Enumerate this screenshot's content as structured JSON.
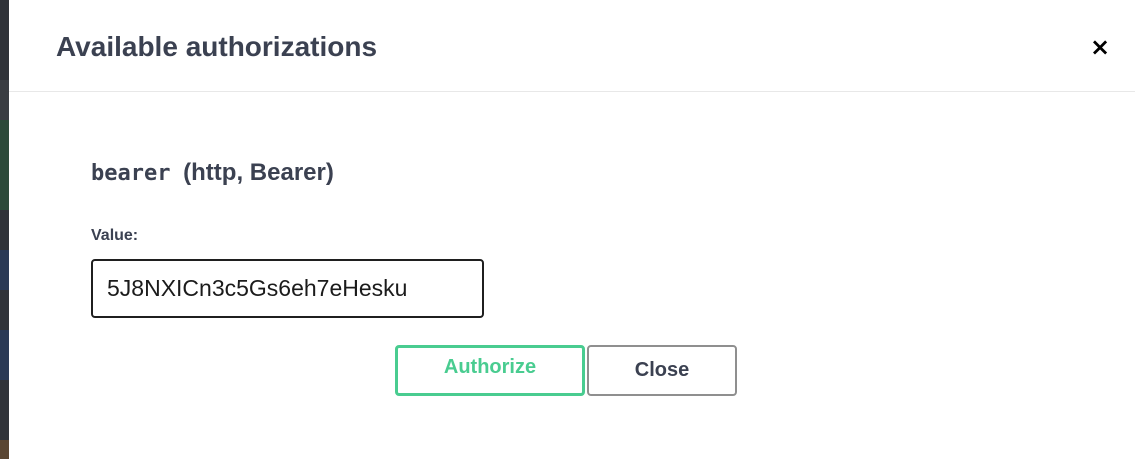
{
  "modal": {
    "title": "Available authorizations",
    "close_icon": "×"
  },
  "auth": {
    "name": "bearer",
    "type": "(http, Bearer)",
    "value_label": "Value:",
    "value": "5J8NXICn3c5Gs6eh7eHesku"
  },
  "buttons": {
    "authorize_label": "Authorize",
    "close_label": "Close"
  },
  "colors": {
    "authorize_accent": "#49cc90",
    "text": "#3b4151"
  }
}
